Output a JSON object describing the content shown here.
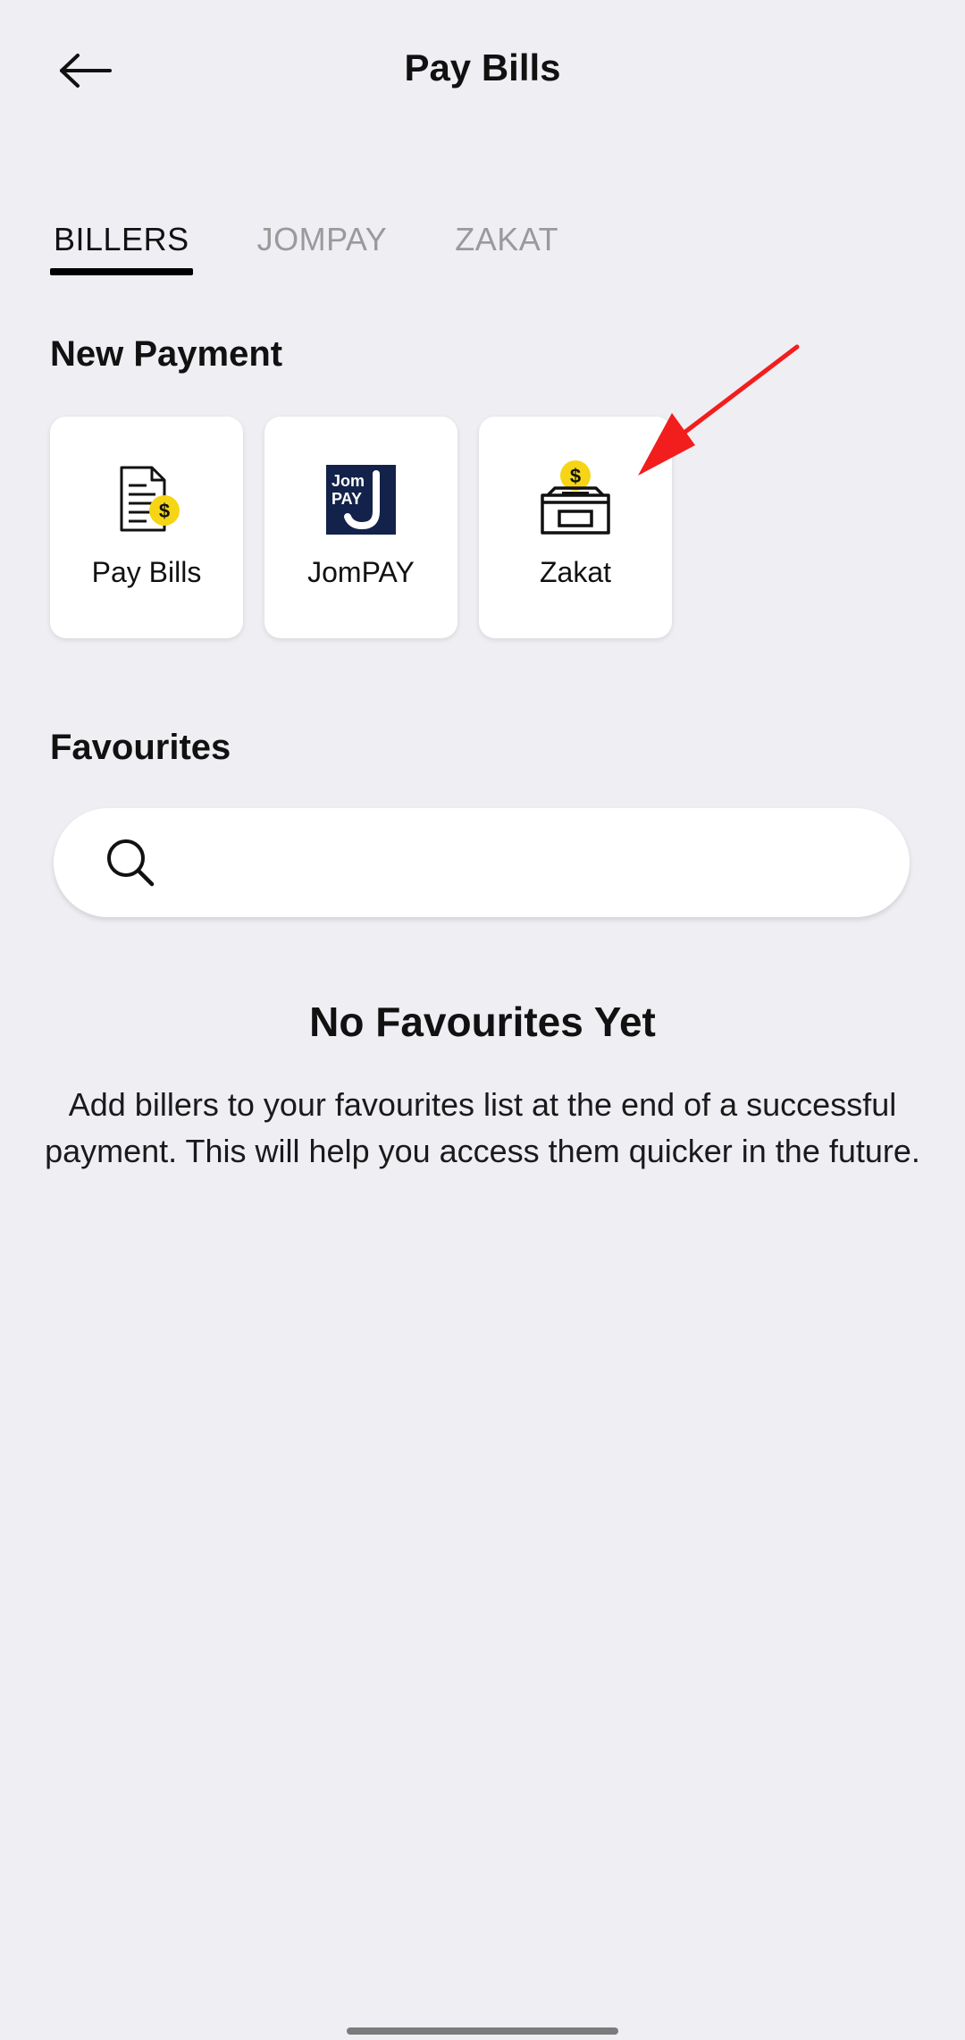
{
  "header": {
    "title": "Pay Bills"
  },
  "tabs": [
    {
      "label": "BILLERS",
      "active": true
    },
    {
      "label": "JOMPAY",
      "active": false
    },
    {
      "label": "ZAKAT",
      "active": false
    }
  ],
  "new_payment": {
    "title": "New Payment",
    "cards": [
      {
        "label": "Pay Bills",
        "icon": "bill-document-dollar-icon"
      },
      {
        "label": "JomPAY",
        "icon": "jompay-logo-icon",
        "logo_text_top": "Jom",
        "logo_text_bottom": "PAY"
      },
      {
        "label": "Zakat",
        "icon": "donation-box-coin-icon"
      }
    ]
  },
  "favourites": {
    "title": "Favourites",
    "search_placeholder": "",
    "empty_title": "No Favourites Yet",
    "empty_description": "Add billers to your favourites list at the end of a successful payment. This will help you access them quicker in the future."
  },
  "colors": {
    "background": "#efeef3",
    "coin": "#f5d515",
    "jompay_navy": "#12224a",
    "annotation_arrow": "#f21d1d"
  }
}
